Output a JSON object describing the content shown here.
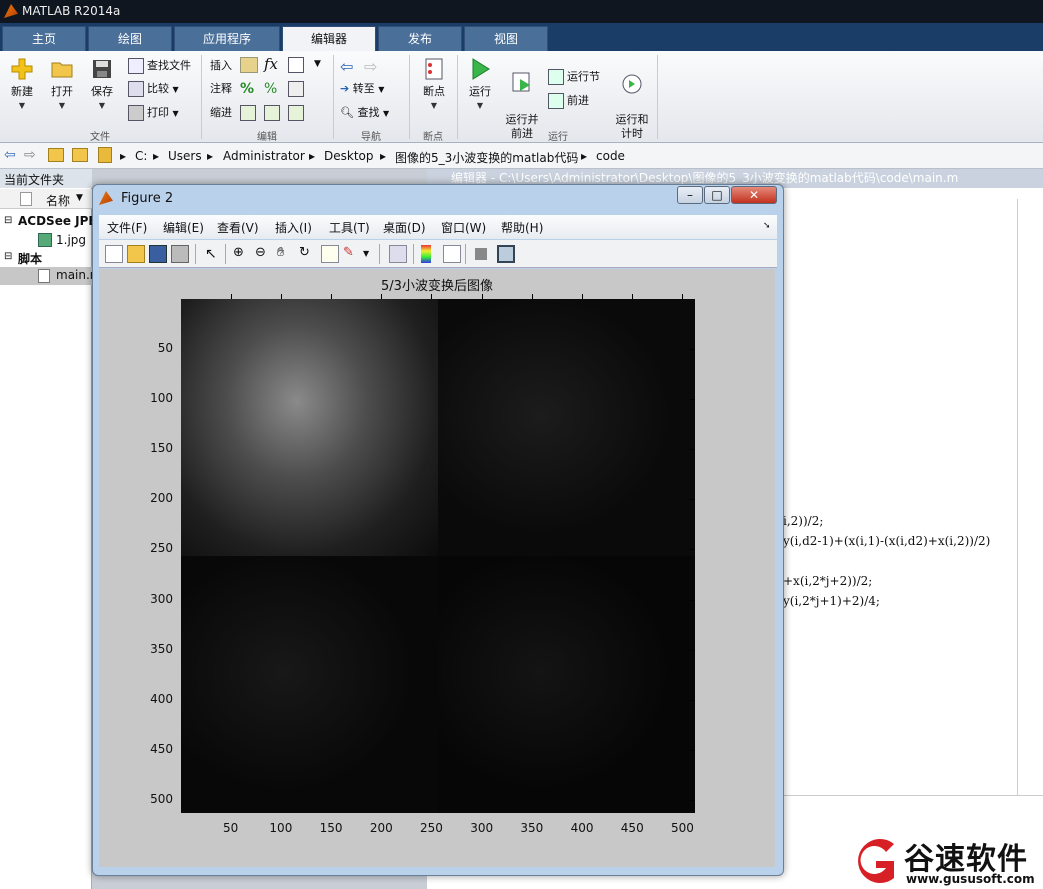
{
  "app": {
    "title": "MATLAB R2014a"
  },
  "tabs": [
    {
      "label": "主页"
    },
    {
      "label": "绘图"
    },
    {
      "label": "应用程序"
    },
    {
      "label": "编辑器"
    },
    {
      "label": "发布"
    },
    {
      "label": "视图"
    }
  ],
  "ribbon": {
    "file": {
      "new": "新建",
      "open": "打开",
      "save": "保存",
      "find_files": "查找文件",
      "compare": "比较",
      "print": "打印",
      "group": "文件"
    },
    "edit": {
      "insert": "插入",
      "comment": "注释",
      "indent": "缩进",
      "group": "编辑"
    },
    "nav": {
      "goto": "转至",
      "find": "查找",
      "group": "导航"
    },
    "breakpoints": {
      "label": "断点",
      "group": "断点"
    },
    "run": {
      "run": "运行",
      "run_advance": "运行并\n前进",
      "run_section": "运行节",
      "advance": "前进",
      "run_time": "运行和\n计时",
      "group": "运行"
    }
  },
  "address": {
    "parts": [
      "C:",
      "Users",
      "Administrator",
      "Desktop",
      "图像的5_3小波变换的matlab代码",
      "code"
    ]
  },
  "left": {
    "title": "当前文件夹",
    "col": "名称",
    "acdsee": "ACDSee JPE",
    "jpg": "1.jpg",
    "script": "脚本",
    "main": "main.m"
  },
  "editor": {
    "title": "编辑器 - C:\\Users\\Administrator\\Desktop\\图像的5_3小波变换的matlab代码\\code\\main.m",
    "lines": [
      "i,2))/2;",
      "y(i,d2-1)+(x(i,1)-(x(i,d2)+x(i,2))/2)",
      "",
      "+x(i,2*j+2))/2;",
      "y(i,2*j+1)+2)/4;"
    ]
  },
  "figure": {
    "title": "Figure 2",
    "menus": [
      "文件(F)",
      "编辑(E)",
      "查看(V)",
      "插入(I)",
      "工具(T)",
      "桌面(D)",
      "窗口(W)",
      "帮助(H)"
    ],
    "plot_title": "5/3小波变换后图像",
    "yticks": [
      "50",
      "100",
      "150",
      "200",
      "250",
      "300",
      "350",
      "400",
      "450",
      "500"
    ],
    "xticks": [
      "50",
      "100",
      "150",
      "200",
      "250",
      "300",
      "350",
      "400",
      "450",
      "500"
    ]
  },
  "watermark": {
    "brand": "谷速软件",
    "url": "www.gususoft.com",
    "color": "#d71f26"
  }
}
